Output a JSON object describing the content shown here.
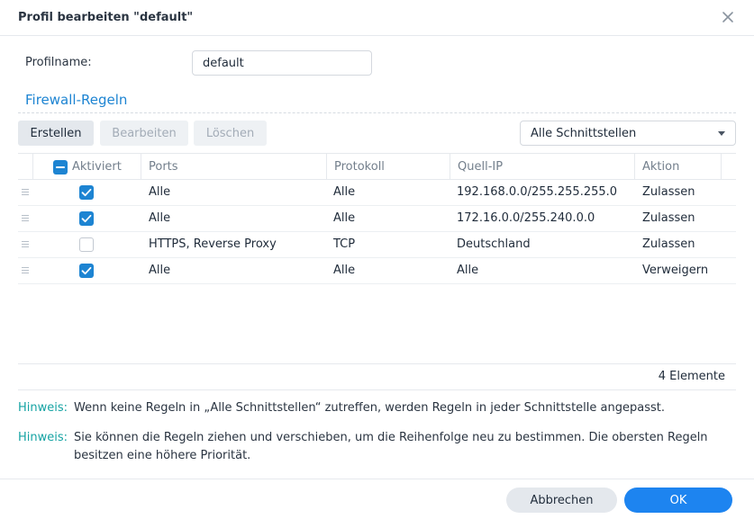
{
  "dialog": {
    "title": "Profil bearbeiten \"default\""
  },
  "profile": {
    "label": "Profilname:",
    "value": "default"
  },
  "section": {
    "title": "Firewall-Regeln"
  },
  "toolbar": {
    "create_label": "Erstellen",
    "edit_label": "Bearbeiten",
    "delete_label": "Löschen",
    "interface_select": "Alle Schnittstellen"
  },
  "table": {
    "columns": [
      "Aktiviert",
      "Ports",
      "Protokoll",
      "Quell-IP",
      "Aktion"
    ],
    "rows": [
      {
        "enabled": true,
        "ports": "Alle",
        "protocol": "Alle",
        "source_ip": "192.168.0.0/255.255.255.0",
        "action": "Zulassen"
      },
      {
        "enabled": true,
        "ports": "Alle",
        "protocol": "Alle",
        "source_ip": "172.16.0.0/255.240.0.0",
        "action": "Zulassen"
      },
      {
        "enabled": false,
        "ports": "HTTPS, Reverse Proxy",
        "protocol": "TCP",
        "source_ip": "Deutschland",
        "action": "Zulassen"
      },
      {
        "enabled": true,
        "ports": "Alle",
        "protocol": "Alle",
        "source_ip": "Alle",
        "action": "Verweigern"
      }
    ],
    "count_text": "4 Elemente"
  },
  "notes": [
    {
      "label": "Hinweis:",
      "text": "Wenn keine Regeln in „Alle Schnittstellen“ zutreffen, werden Regeln in jeder Schnittstelle angepasst."
    },
    {
      "label": "Hinweis:",
      "text": "Sie können die Regeln ziehen und verschieben, um die Reihenfolge neu zu bestimmen. Die obersten Regeln besitzen eine höhere Priorität."
    }
  ],
  "footer": {
    "cancel_label": "Abbrechen",
    "ok_label": "OK"
  },
  "colors": {
    "accent": "#1d84d2",
    "primary_button": "#1d84f0",
    "note_label": "#15a3a3"
  },
  "icons": {
    "close": "close-icon",
    "caret": "chevron-down-icon",
    "drag": "drag-handle-icon",
    "check": "check-icon"
  }
}
